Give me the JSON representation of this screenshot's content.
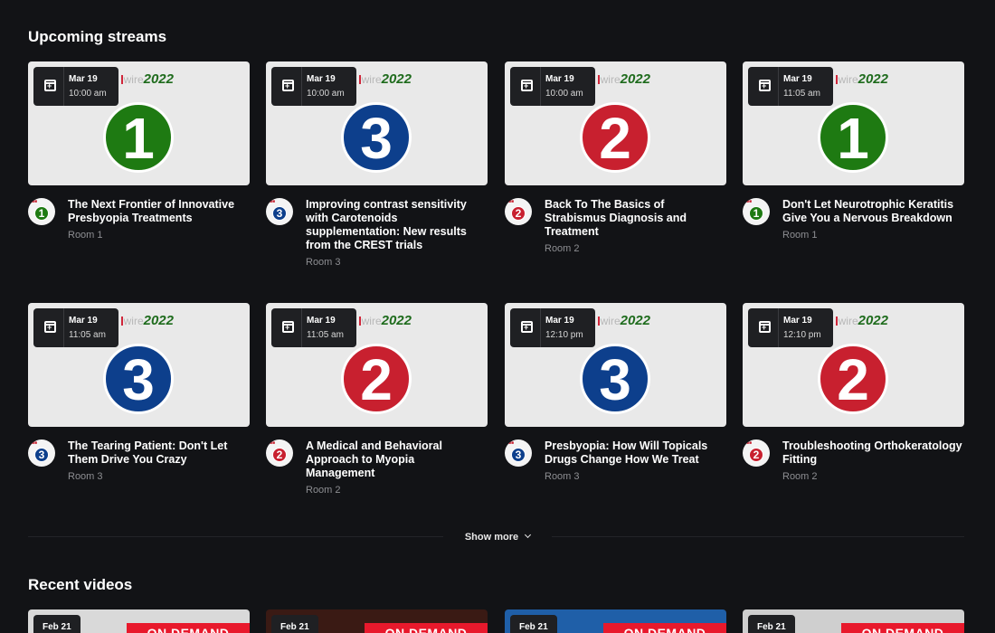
{
  "upcoming": {
    "title": "Upcoming streams",
    "brand_text": "wire",
    "brand_year": "2022",
    "streams": [
      {
        "date": "Mar 19",
        "time": "10:00 am",
        "number": "1",
        "color": "g",
        "title": "The Next Frontier of Innovative Presbyopia Treatments",
        "room": "Room 1"
      },
      {
        "date": "Mar 19",
        "time": "10:00 am",
        "number": "3",
        "color": "b",
        "title": "Improving contrast sensitivity with Carotenoids supplementation: New results from the CREST trials",
        "room": "Room 3"
      },
      {
        "date": "Mar 19",
        "time": "10:00 am",
        "number": "2",
        "color": "r",
        "title": "Back To The Basics of Strabismus Diagnosis and Treatment",
        "room": "Room 2"
      },
      {
        "date": "Mar 19",
        "time": "11:05 am",
        "number": "1",
        "color": "g",
        "title": "Don't Let Neurotrophic Keratitis Give You a Nervous Breakdown",
        "room": "Room 1"
      },
      {
        "date": "Mar 19",
        "time": "11:05 am",
        "number": "3",
        "color": "b",
        "title": "The Tearing Patient: Don't Let Them Drive You Crazy",
        "room": "Room 3"
      },
      {
        "date": "Mar 19",
        "time": "11:05 am",
        "number": "2",
        "color": "r",
        "title": "A Medical and Behavioral Approach to Myopia Management",
        "room": "Room 2"
      },
      {
        "date": "Mar 19",
        "time": "12:10 pm",
        "number": "3",
        "color": "b",
        "title": "Presbyopia: How Will Topicals Drugs Change How We Treat",
        "room": "Room 3"
      },
      {
        "date": "Mar 19",
        "time": "12:10 pm",
        "number": "2",
        "color": "r",
        "title": "Troubleshooting Orthokeratology Fitting",
        "room": "Room 2"
      }
    ]
  },
  "show_more_label": "Show more",
  "recent": {
    "title": "Recent videos",
    "videos": [
      {
        "date": "Feb 21",
        "label": "ON DEMAND",
        "bg": "#d9d9d9"
      },
      {
        "date": "Feb 21",
        "label": "ON DEMAND",
        "bg": "#3a1a14"
      },
      {
        "date": "Feb 21",
        "label": "ON DEMAND",
        "bg": "#1f5fa8"
      },
      {
        "date": "Feb 21",
        "label": "ON DEMAND",
        "bg": "#cfcfcf"
      }
    ]
  },
  "colors": {
    "green": "#1e7a12",
    "blue": "#0d3f8c",
    "red": "#c8202f",
    "background": "#121316"
  }
}
